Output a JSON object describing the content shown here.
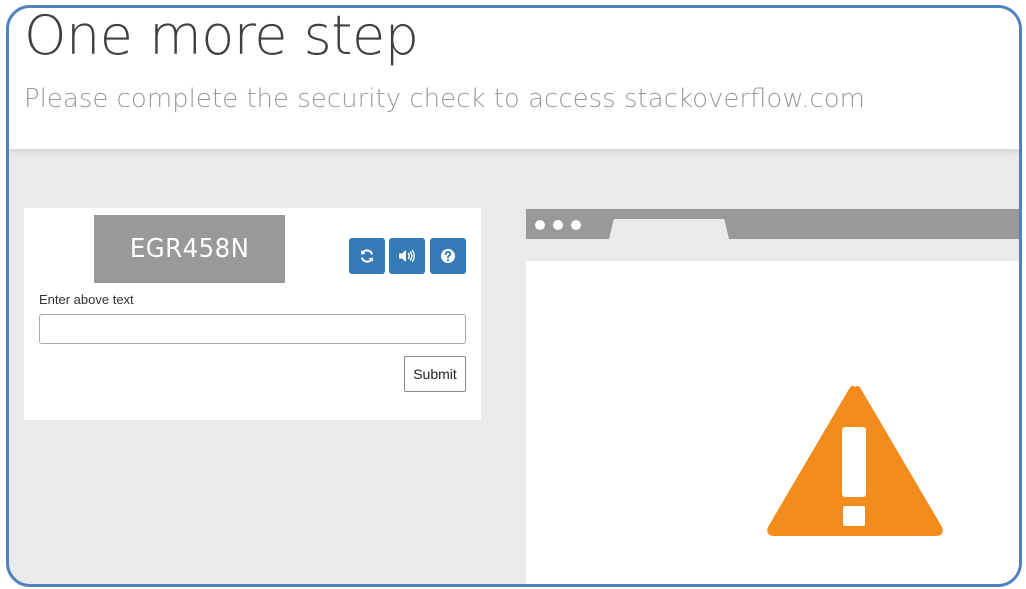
{
  "header": {
    "title": "One more step",
    "subtitle": "Please complete the security check to access stackoverflow.com"
  },
  "captcha": {
    "image_text": "EGR458N",
    "field_label": "Enter above text",
    "input_value": "",
    "submit_label": "Submit",
    "buttons": {
      "refresh_icon": "refresh-icon",
      "audio_icon": "audio-icon",
      "help_icon": "help-icon"
    }
  },
  "illustration": {
    "icon": "warning-icon",
    "accent_color": "#f38b1d"
  },
  "colors": {
    "frame_border": "#4f81bd",
    "button_blue": "#337ab7",
    "background": "#eaeaea"
  }
}
